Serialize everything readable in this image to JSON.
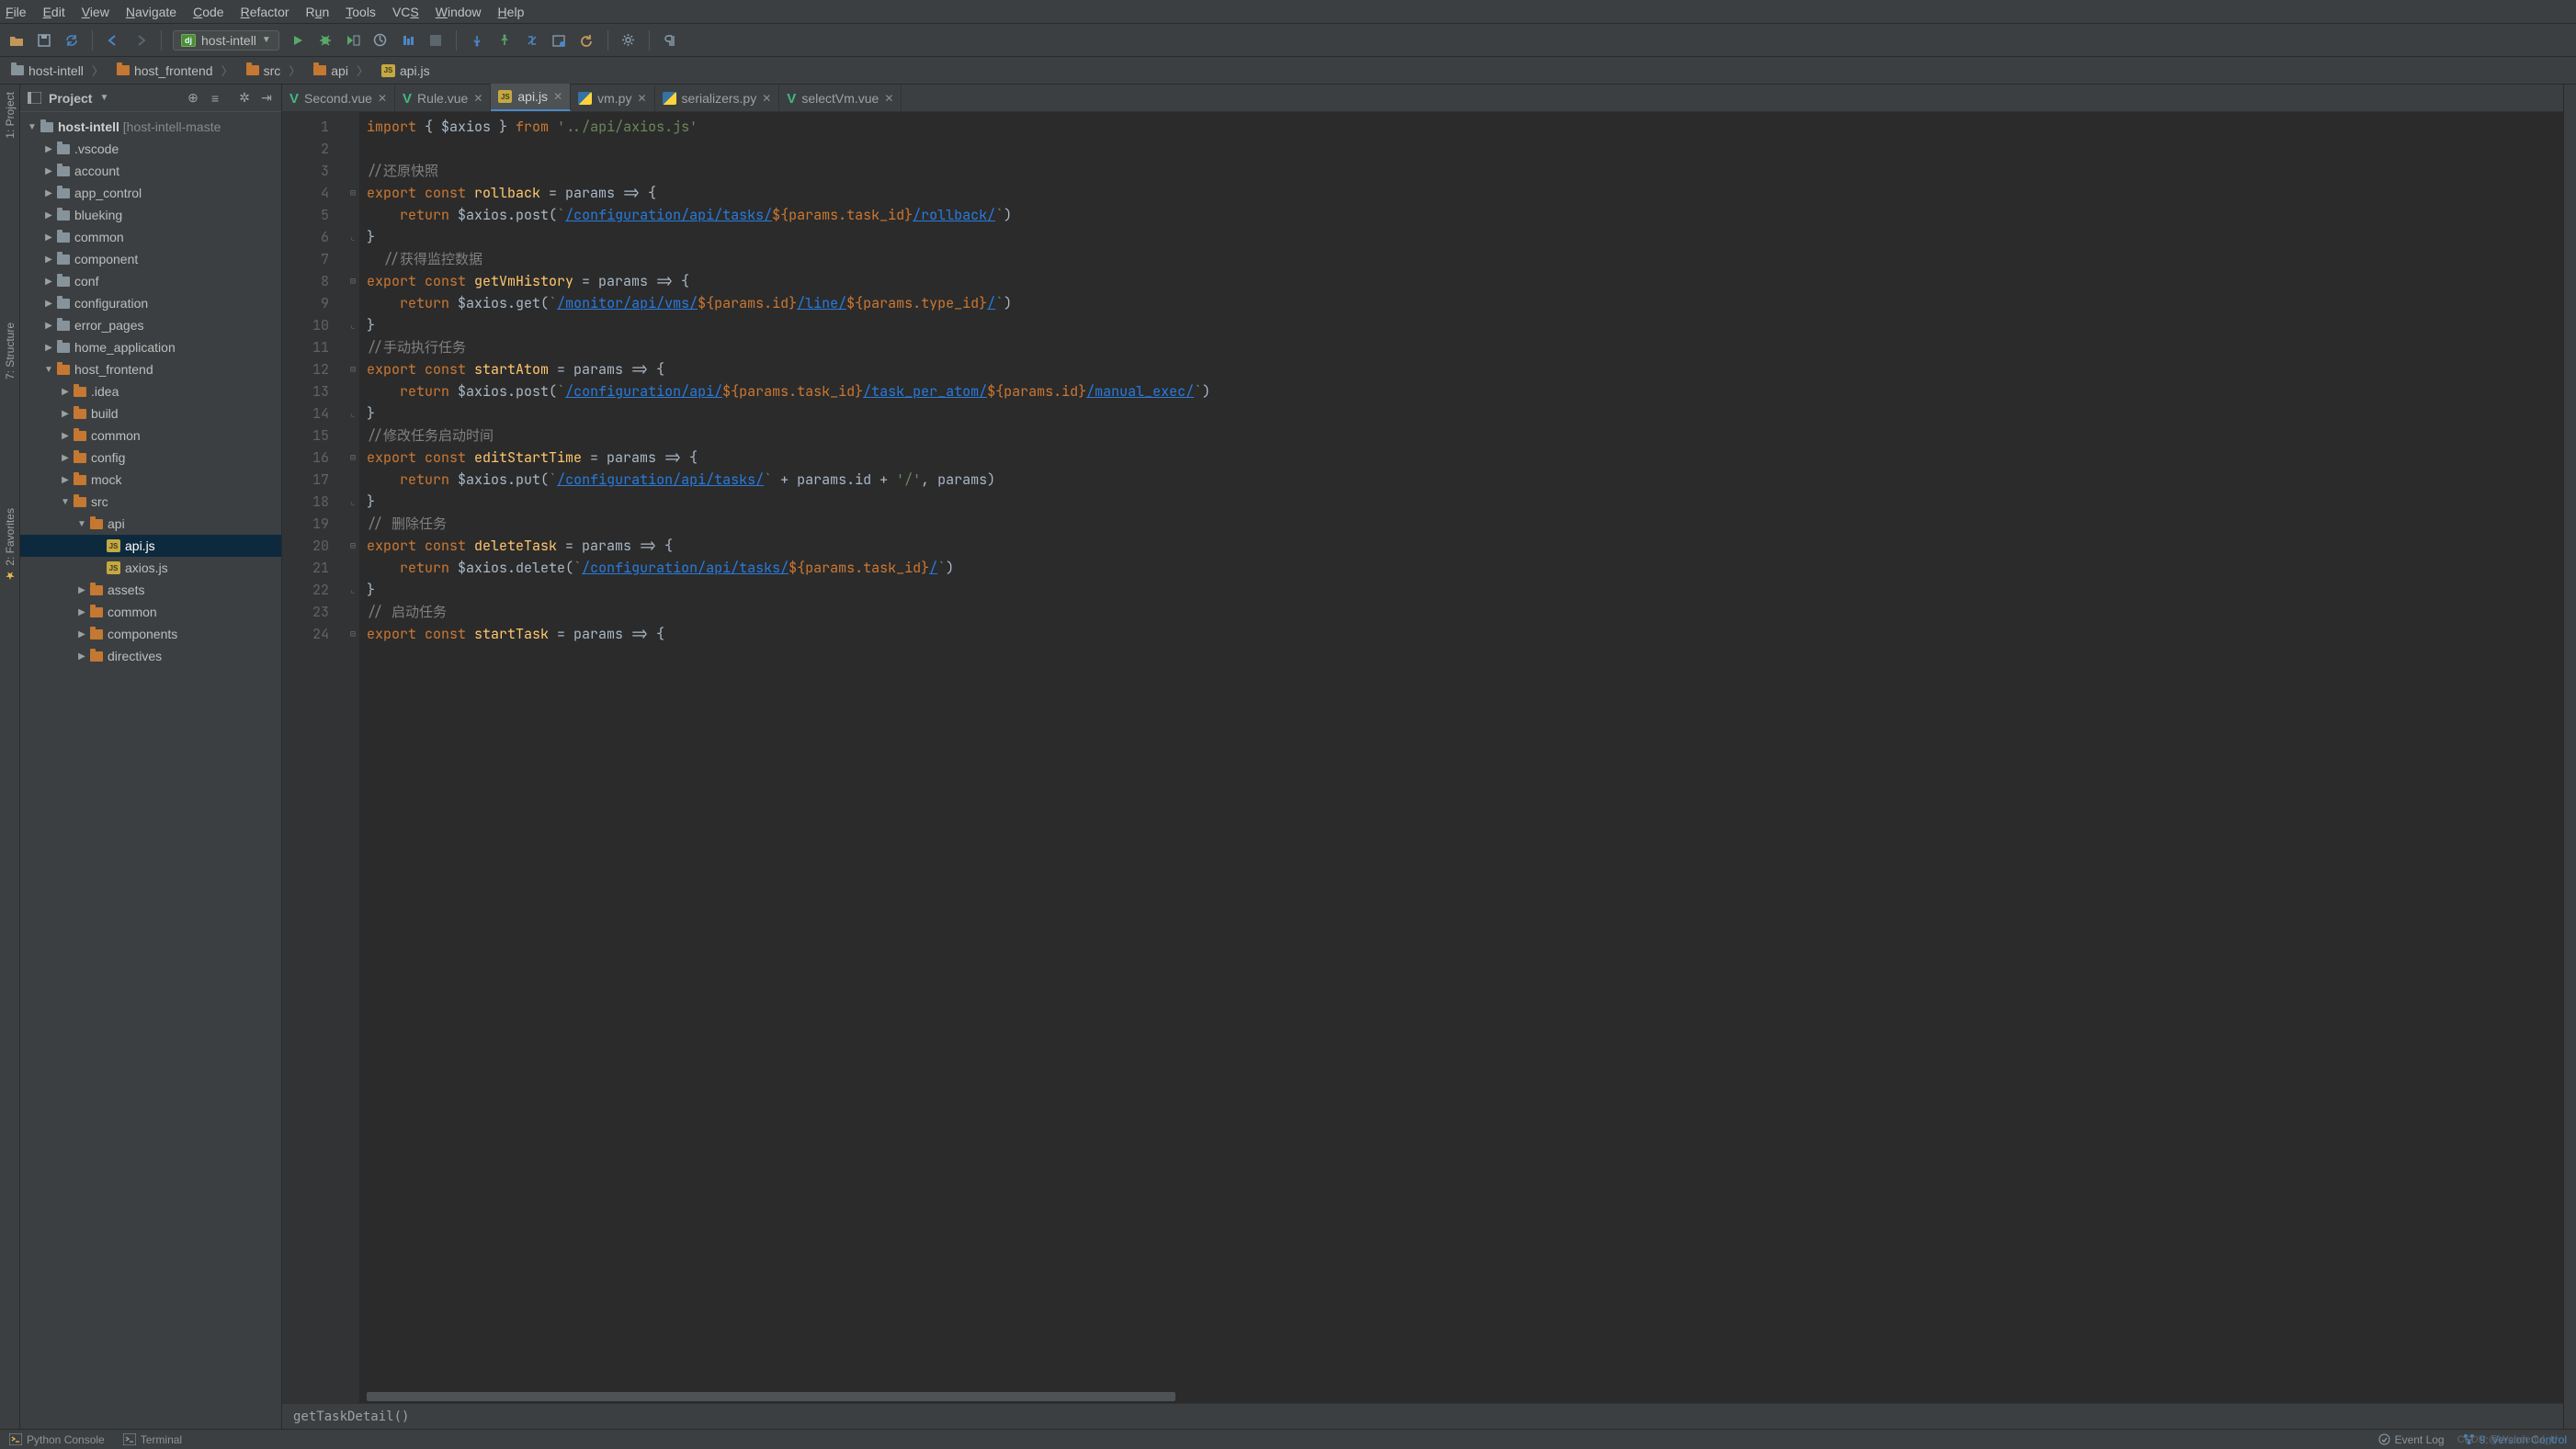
{
  "menu": [
    "File",
    "Edit",
    "View",
    "Navigate",
    "Code",
    "Refactor",
    "Run",
    "Tools",
    "VCS",
    "Window",
    "Help"
  ],
  "run_config": "host-intell",
  "breadcrumbs": [
    {
      "label": "host-intell",
      "icon": "gray"
    },
    {
      "label": "host_frontend",
      "icon": "orange"
    },
    {
      "label": "src",
      "icon": "orange"
    },
    {
      "label": "api",
      "icon": "orange"
    },
    {
      "label": "api.js",
      "icon": "js"
    }
  ],
  "project": {
    "title": "Project",
    "root": {
      "label": "host-intell",
      "suffix": " [host-intell-maste"
    },
    "root_children": [
      ".vscode",
      "account",
      "app_control",
      "blueking",
      "common",
      "component",
      "conf",
      "configuration",
      "error_pages",
      "home_application"
    ],
    "host_frontend": "host_frontend",
    "hf_children": [
      ".idea",
      "build",
      "common",
      "config",
      "mock"
    ],
    "src": "src",
    "api": "api",
    "api_files": [
      "api.js",
      "axios.js"
    ],
    "after_api": [
      "assets",
      "common",
      "components",
      "directives"
    ]
  },
  "tabs": [
    {
      "label": "Second.vue",
      "type": "vue"
    },
    {
      "label": "Rule.vue",
      "type": "vue"
    },
    {
      "label": "api.js",
      "type": "js",
      "active": true
    },
    {
      "label": "vm.py",
      "type": "py"
    },
    {
      "label": "serializers.py",
      "type": "py"
    },
    {
      "label": "selectVm.vue",
      "type": "vue"
    }
  ],
  "code": {
    "lines": [
      {
        "n": 1,
        "t": "import-line"
      },
      {
        "n": 2,
        "t": "blank"
      },
      {
        "n": 3,
        "t": "cmt",
        "text": "//还原快照"
      },
      {
        "n": 4,
        "t": "export",
        "name": "rollback",
        "param": "params"
      },
      {
        "n": 5,
        "t": "return",
        "method": "post",
        "pre": "/configuration/api/tasks/",
        "expr": "${params.task_id}",
        "post": "/rollback/"
      },
      {
        "n": 6,
        "t": "close"
      },
      {
        "n": 7,
        "t": "cmt",
        "text": "//获得监控数据",
        "indent": 1
      },
      {
        "n": 8,
        "t": "export",
        "name": "getVmHistory",
        "param": "params"
      },
      {
        "n": 9,
        "t": "return",
        "method": "get",
        "pre": "/monitor/api/vms/",
        "expr": "${params.id}",
        "mid": "/line/",
        "expr2": "${params.type_id}",
        "post": "/"
      },
      {
        "n": 10,
        "t": "close"
      },
      {
        "n": 11,
        "t": "cmt",
        "text": "//手动执行任务"
      },
      {
        "n": 12,
        "t": "export",
        "name": "startAtom",
        "param": "params"
      },
      {
        "n": 13,
        "t": "return",
        "method": "post",
        "pre": "/configuration/api/",
        "expr": "${params.task_id}",
        "mid": "/task_per_atom/",
        "expr2": "${params.id}",
        "post": "/manual_exec/"
      },
      {
        "n": 14,
        "t": "close"
      },
      {
        "n": 15,
        "t": "cmt",
        "text": "//修改任务启动时间"
      },
      {
        "n": 16,
        "t": "export",
        "name": "editStartTime",
        "param": "params"
      },
      {
        "n": 17,
        "t": "return-put"
      },
      {
        "n": 18,
        "t": "close"
      },
      {
        "n": 19,
        "t": "cmt",
        "text": "// 删除任务"
      },
      {
        "n": 20,
        "t": "export",
        "name": "deleteTask",
        "param": "params"
      },
      {
        "n": 21,
        "t": "return",
        "method": "delete",
        "pre": "/configuration/api/tasks/",
        "expr": "${params.task_id}",
        "post": "/"
      },
      {
        "n": 22,
        "t": "close"
      },
      {
        "n": 23,
        "t": "cmt",
        "text": "// 启动任务"
      },
      {
        "n": 24,
        "t": "export",
        "name": "startTask",
        "param": "params"
      }
    ],
    "import_from": "'../api/axios.js'",
    "put_url": "/configuration/api/tasks/"
  },
  "editor_breadcrumb": "getTaskDetail()",
  "left_tabs": [
    {
      "label": "1: Project"
    },
    {
      "label": "7: Structure"
    },
    {
      "label": "2: Favorites"
    }
  ],
  "status": {
    "python_console": "Python Console",
    "terminal": "Terminal",
    "event_log": "Event Log",
    "vcs": "9: Version Control"
  },
  "watermark": "CSDN @Wonderful_U"
}
